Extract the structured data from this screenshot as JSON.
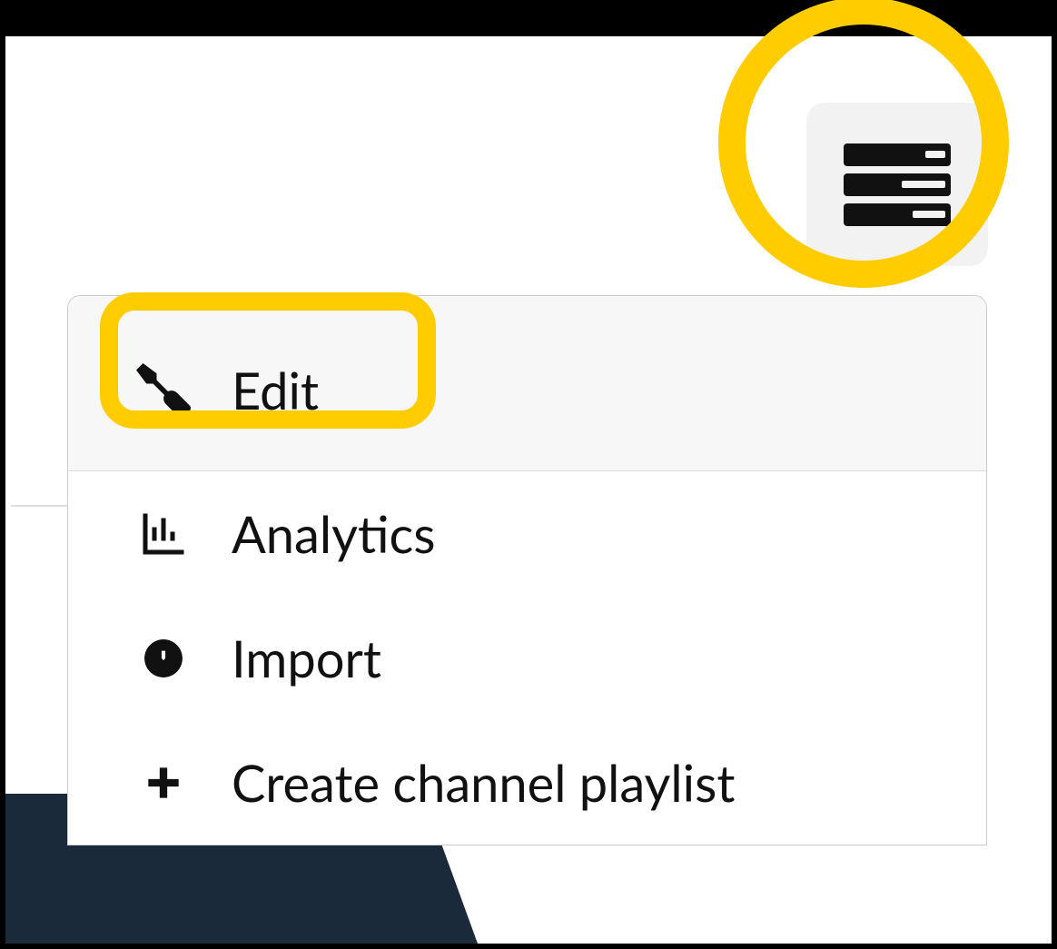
{
  "menu": {
    "trigger_icon": "settings-list-icon",
    "items": [
      {
        "icon": "wrench-icon",
        "label": "Edit"
      },
      {
        "icon": "bar-chart-icon",
        "label": "Analytics"
      },
      {
        "icon": "download-circle-icon",
        "label": "Import"
      },
      {
        "icon": "plus-icon",
        "label": "Create channel playlist"
      }
    ]
  },
  "highlights": {
    "menu_button_circled": true,
    "edit_item_boxed": true,
    "highlight_color": "#ffcc00"
  }
}
